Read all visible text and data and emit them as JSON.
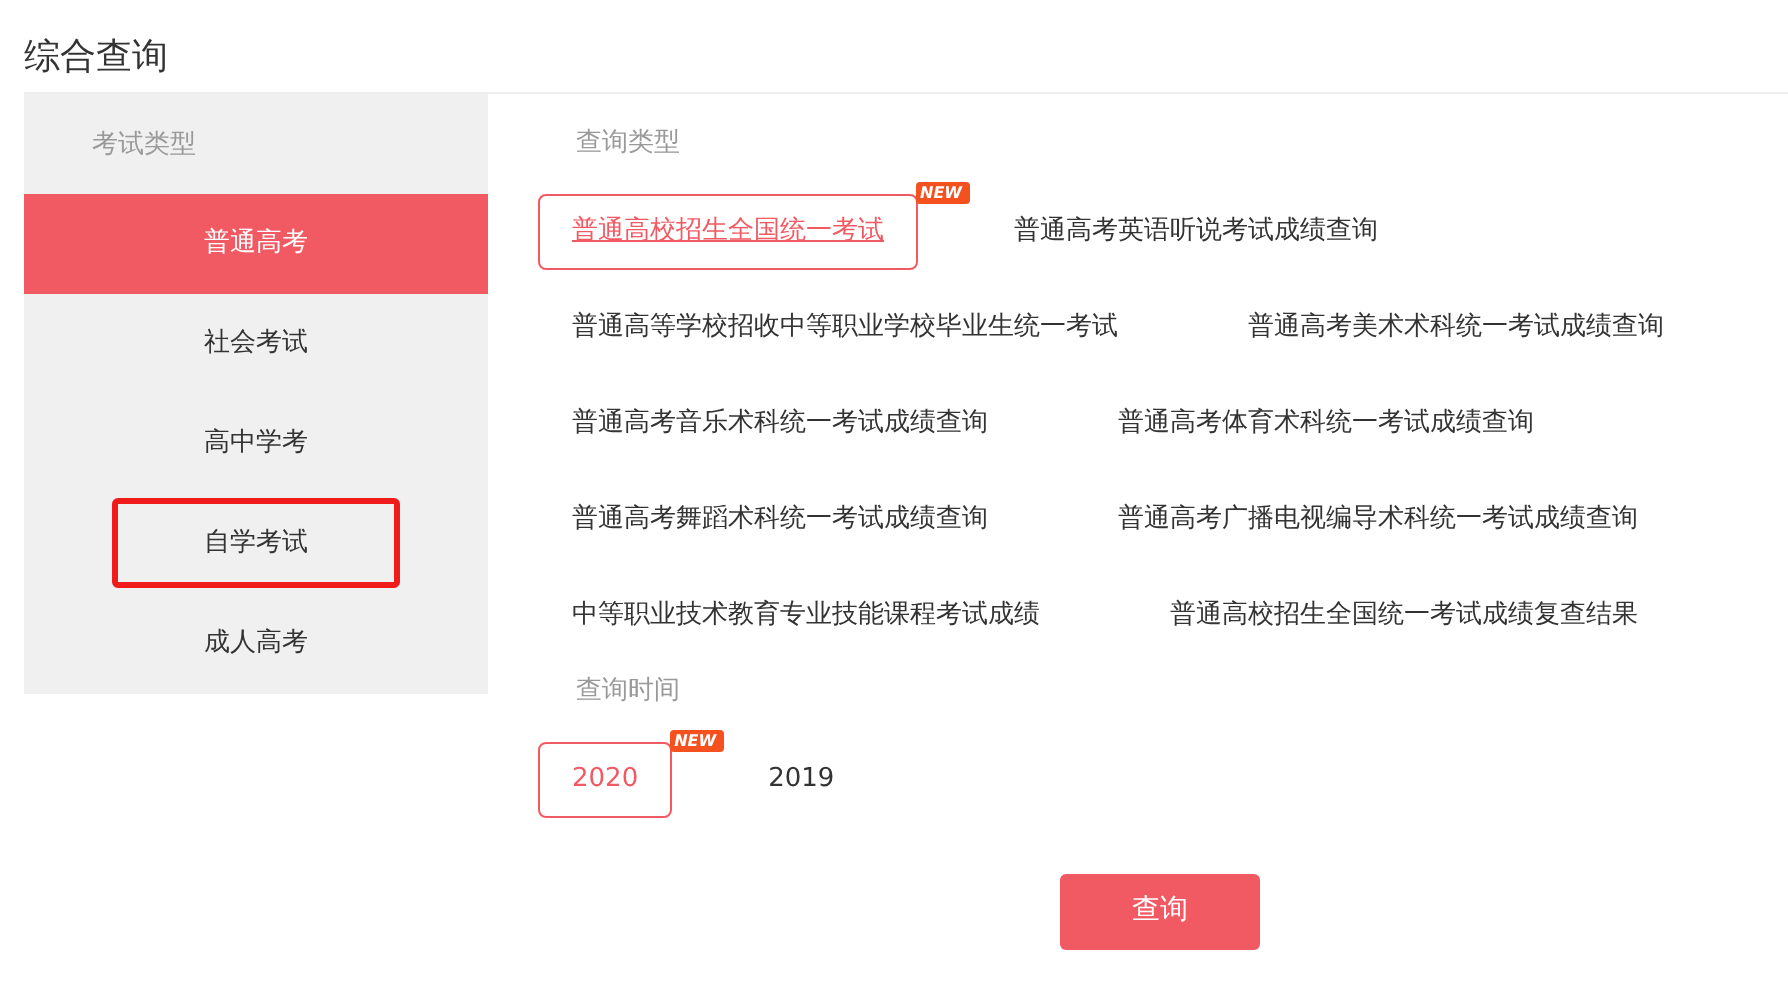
{
  "title": "综合查询",
  "sidebar": {
    "heading": "考试类型",
    "items": [
      {
        "label": "普通高考",
        "selected": true,
        "highlighted": false
      },
      {
        "label": "社会考试",
        "selected": false,
        "highlighted": false
      },
      {
        "label": "高中学考",
        "selected": false,
        "highlighted": false
      },
      {
        "label": "自学考试",
        "selected": false,
        "highlighted": true
      },
      {
        "label": "成人高考",
        "selected": false,
        "highlighted": false
      }
    ]
  },
  "query_type": {
    "heading": "查询类型",
    "rows": [
      [
        {
          "label": "普通高校招生全国统一考试",
          "selected": true,
          "badge": "NEW"
        },
        {
          "label": "普通高考英语听说考试成绩查询",
          "selected": false
        }
      ],
      [
        {
          "label": "普通高等学校招收中等职业学校毕业生统一考试",
          "selected": false
        },
        {
          "label": "普通高考美术术科统一考试成绩查询",
          "selected": false
        }
      ],
      [
        {
          "label": "普通高考音乐术科统一考试成绩查询",
          "selected": false
        },
        {
          "label": "普通高考体育术科统一考试成绩查询",
          "selected": false
        }
      ],
      [
        {
          "label": "普通高考舞蹈术科统一考试成绩查询",
          "selected": false
        },
        {
          "label": "普通高考广播电视编导术科统一考试成绩查询",
          "selected": false
        }
      ],
      [
        {
          "label": "中等职业技术教育专业技能课程考试成绩",
          "selected": false
        },
        {
          "label": "普通高校招生全国统一考试成绩复查结果",
          "selected": false
        }
      ]
    ]
  },
  "query_time": {
    "heading": "查询时间",
    "years": [
      {
        "label": "2020",
        "selected": true,
        "badge": "NEW"
      },
      {
        "label": "2019",
        "selected": false
      }
    ]
  },
  "submit_button": "查询"
}
